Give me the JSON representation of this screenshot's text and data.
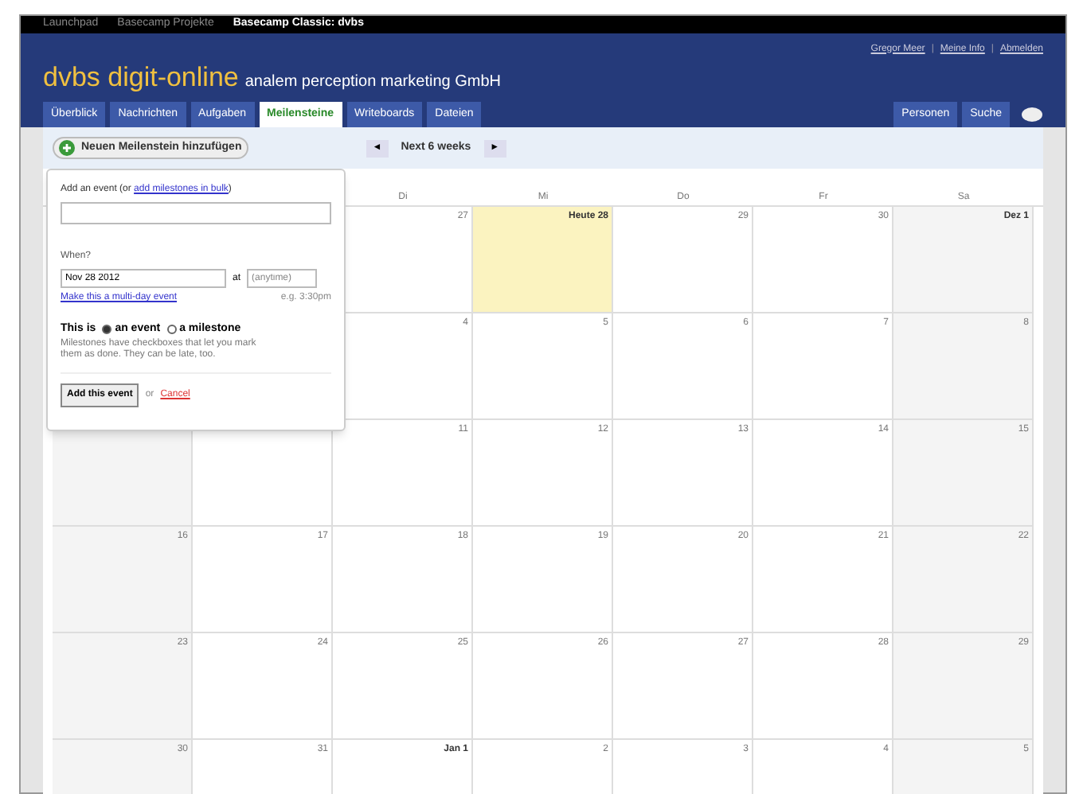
{
  "top_bar": {
    "links": [
      {
        "label": "Launchpad",
        "selected": false
      },
      {
        "label": "Basecamp Projekte",
        "selected": false
      },
      {
        "label": "Basecamp Classic: dvbs",
        "selected": true
      }
    ]
  },
  "user_links": [
    {
      "kind": "link",
      "label": "Gregor Meer"
    },
    {
      "kind": "separator",
      "label": "|"
    },
    {
      "kind": "link",
      "label": "Meine Info"
    },
    {
      "kind": "separator",
      "label": "|"
    },
    {
      "kind": "link",
      "label": "Abmelden"
    }
  ],
  "header": {
    "title": "dvbs digit-online",
    "subtitle": "analem perception marketing GmbH"
  },
  "tabs": [
    {
      "label": "Überblick",
      "selected": false
    },
    {
      "label": "Nachrichten",
      "selected": false
    },
    {
      "label": "Aufgaben",
      "selected": false
    },
    {
      "label": "Meilensteine",
      "selected": true
    },
    {
      "label": "Writeboards",
      "selected": false
    },
    {
      "label": "Dateien",
      "selected": false
    }
  ],
  "right_tabs": [
    {
      "label": "Personen",
      "selected": false
    },
    {
      "label": "Suche",
      "selected": false
    }
  ],
  "add_button": "Neuen Meilenstein hinzufügen",
  "nav": {
    "prev": "◄",
    "label": "Next 6 weeks",
    "next": "►"
  },
  "weekdays": [
    "Di",
    "Mi",
    "Do",
    "Fr",
    "Sa"
  ],
  "weeks": [
    [
      {
        "label": "27",
        "today": false
      },
      {
        "label": "Heute 28",
        "today": true
      },
      {
        "label": "29",
        "today": false
      },
      {
        "label": "30",
        "today": false
      },
      {
        "label": "Dez 1",
        "today": false
      }
    ],
    [
      {
        "label": "4",
        "today": false
      },
      {
        "label": "5",
        "today": false
      },
      {
        "label": "6",
        "today": false
      },
      {
        "label": "7",
        "today": false
      },
      {
        "label": "8",
        "today": false
      }
    ],
    [
      {
        "label": "11",
        "today": false
      },
      {
        "label": "12",
        "today": false
      },
      {
        "label": "13",
        "today": false
      },
      {
        "label": "14",
        "today": false
      },
      {
        "label": "15",
        "today": false
      }
    ],
    [
      {
        "label": "16",
        "today": false
      },
      {
        "label": "17",
        "today": false
      },
      {
        "label": "18",
        "today": false
      },
      {
        "label": "19",
        "today": false
      },
      {
        "label": "20",
        "today": false
      },
      {
        "label": "21",
        "today": false
      },
      {
        "label": "22",
        "today": false
      }
    ],
    [
      {
        "label": "23",
        "today": false
      },
      {
        "label": "24",
        "today": false
      },
      {
        "label": "25",
        "today": false
      },
      {
        "label": "26",
        "today": false
      },
      {
        "label": "27",
        "today": false
      },
      {
        "label": "28",
        "today": false
      },
      {
        "label": "29",
        "today": false
      }
    ],
    [
      {
        "label": "30",
        "today": false
      },
      {
        "label": "31",
        "today": false
      },
      {
        "label": "Jan 1",
        "today": false
      },
      {
        "label": "2",
        "today": false
      },
      {
        "label": "3",
        "today": false
      },
      {
        "label": "4",
        "today": false
      },
      {
        "label": "5",
        "today": false
      }
    ]
  ],
  "popup": {
    "heading": "Add an event (or",
    "heading_link": "add milestones in bulk",
    "heading_end": ")",
    "when_label": "When?",
    "date_value": "Nov 28 2012",
    "at": "at",
    "time_placeholder": "(anytime)",
    "multi_day_link": "Make this a multi-day event",
    "time_hint": "e.g. 3:30pm",
    "type_label": "This is",
    "types": [
      {
        "label": "an event",
        "selected": true
      },
      {
        "label": "a milestone",
        "selected": false
      }
    ],
    "note": "Milestones have checkboxes that let you mark them as done. They can be late, too.",
    "submit": "Add this event",
    "or": "or",
    "cancel": "Cancel"
  }
}
